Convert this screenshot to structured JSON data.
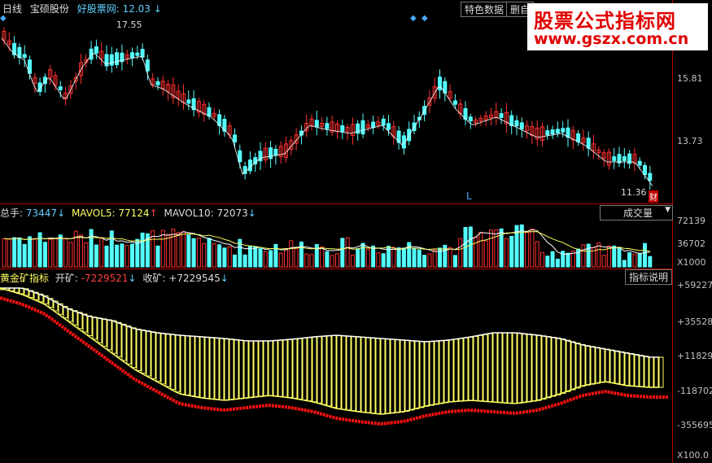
{
  "header": {
    "period": "日线",
    "stock_name": "宝硕股份",
    "site": "好股票网:",
    "price": "12.03",
    "feature_data": "特色数据",
    "delete": "删自"
  },
  "main_chart": {
    "high_marker": "17.55",
    "low_marker": "11.36",
    "fin_badge": "财",
    "l_marker": "L",
    "price_axis": [
      "15.81",
      "13.73"
    ]
  },
  "volume_panel": {
    "total": "总手:",
    "total_value": "73447",
    "mavol5_label": "MAVOL5:",
    "mavol5_value": "77124",
    "mavol10_label": "MAVOL10:",
    "mavol10_value": "72073",
    "selector": "成交量",
    "axis": [
      "72139",
      "36702",
      "X1000"
    ]
  },
  "indicator_panel": {
    "name": "黄金矿指标",
    "open_label": "开矿:",
    "open_value": "-7229521",
    "close_label": "收矿:",
    "close_value": "+7229545",
    "help_button": "指标说明",
    "axis": [
      "+59227",
      "+35528",
      "+11829",
      "-118702",
      "-355695",
      "X100.0"
    ]
  },
  "watermark": {
    "line1": "股票公式指标网",
    "line2": "www.gszx.com.cn"
  },
  "colors": {
    "up": "#ff3030",
    "down": "#54ffff",
    "yellow": "#ffff60",
    "white": "#ffffff",
    "red_line": "#ff1010"
  }
}
